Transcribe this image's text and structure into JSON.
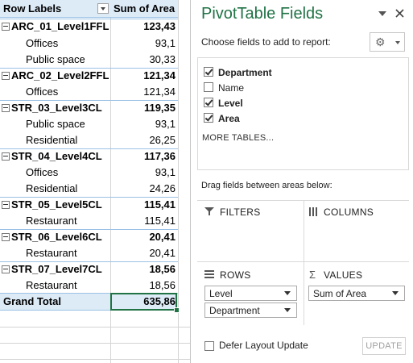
{
  "pivot": {
    "header": {
      "row_labels": "Row Labels",
      "sum_of_area": "Sum of Area"
    },
    "groups": [
      {
        "name": "ARC_01_Level1FFL",
        "total": "123,43",
        "items": [
          {
            "name": "Offices",
            "value": "93,1"
          },
          {
            "name": "Public space",
            "value": "30,33"
          }
        ]
      },
      {
        "name": "ARC_02_Level2FFL",
        "total": "121,34",
        "items": [
          {
            "name": "Offices",
            "value": "121,34"
          }
        ]
      },
      {
        "name": "STR_03_Level3CL",
        "total": "119,35",
        "items": [
          {
            "name": "Public space",
            "value": "93,1"
          },
          {
            "name": "Residential",
            "value": "26,25"
          }
        ]
      },
      {
        "name": "STR_04_Level4CL",
        "total": "117,36",
        "items": [
          {
            "name": "Offices",
            "value": "93,1"
          },
          {
            "name": "Residential",
            "value": "24,26"
          }
        ]
      },
      {
        "name": "STR_05_Level5CL",
        "total": "115,41",
        "items": [
          {
            "name": "Restaurant",
            "value": "115,41"
          }
        ]
      },
      {
        "name": "STR_06_Level6CL",
        "total": "20,41",
        "items": [
          {
            "name": "Restaurant",
            "value": "20,41"
          }
        ]
      },
      {
        "name": "STR_07_Level7CL",
        "total": "18,56",
        "items": [
          {
            "name": "Restaurant",
            "value": "18,56"
          }
        ]
      }
    ],
    "grand_total": {
      "label": "Grand Total",
      "value": "635,86"
    }
  },
  "pane": {
    "title": "PivotTable Fields",
    "choose_text": "Choose fields to add to report:",
    "gear_icon": "gear-icon",
    "fields": [
      {
        "label": "Department",
        "checked": true
      },
      {
        "label": "Name",
        "checked": false
      },
      {
        "label": "Level",
        "checked": true
      },
      {
        "label": "Area",
        "checked": true
      }
    ],
    "more_tables": "MORE TABLES...",
    "drag_hint": "Drag fields between areas below:",
    "areas": {
      "filters": "FILTERS",
      "columns": "COLUMNS",
      "rows": "ROWS",
      "values": "VALUES"
    },
    "rows_fields": [
      "Level",
      "Department"
    ],
    "values_fields": [
      "Sum of Area"
    ],
    "defer_label": "Defer Layout Update",
    "update_label": "UPDATE",
    "accent_color": "#217346"
  }
}
